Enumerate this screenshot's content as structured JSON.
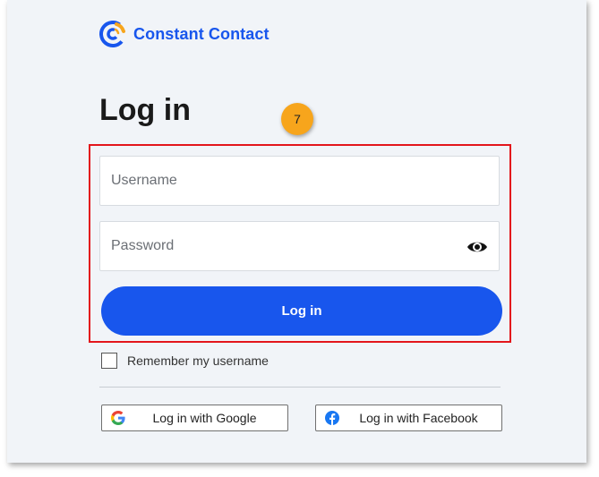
{
  "brand": {
    "name": "Constant Contact",
    "color": "#1856ed",
    "accent": "#f7a51c"
  },
  "page": {
    "title": "Log in"
  },
  "annotation": {
    "step": "7"
  },
  "form": {
    "username_placeholder": "Username",
    "password_placeholder": "Password",
    "submit_label": "Log in",
    "remember_label": "Remember my username",
    "remember_checked": false
  },
  "social": {
    "google_label": "Log in with Google",
    "google_icon": "google-icon",
    "facebook_label": "Log in with Facebook",
    "facebook_icon": "facebook-icon"
  }
}
